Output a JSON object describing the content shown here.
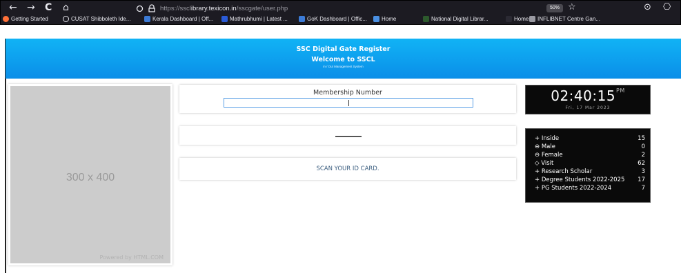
{
  "browser": {
    "nav": {
      "back": "←",
      "forward": "→",
      "reload": "C",
      "home": "⌂"
    },
    "url_prefix": "https://sscl",
    "url_domain": "ibrary.texicon.in",
    "url_path": "/sscgate/user.php",
    "zoom": "50%",
    "bookmarks": [
      {
        "label": "Getting Started",
        "icon_color": "#ff7139"
      },
      {
        "label": "CUSAT Shibboleth Ide...",
        "icon_color": "#e8e8ee"
      },
      {
        "label": "Kerala Dashboard | Off...",
        "icon_color": "#3c7bd6"
      },
      {
        "label": "Mathrubhumi | Latest ...",
        "icon_color": "#2a5bd7"
      },
      {
        "label": "GoK Dashboard | Offic...",
        "icon_color": "#3c7bd6"
      },
      {
        "label": "Home",
        "icon_color": "#4a90e2"
      },
      {
        "label": "National Digital Librar...",
        "icon_color": "#2d5a2d"
      },
      {
        "label": "Home",
        "icon_color": "#2b2a33"
      },
      {
        "label": "INFLIBNET Centre Gan...",
        "icon_color": "#9a9aa2"
      }
    ]
  },
  "header": {
    "title": "SSC Digital Gate Register",
    "welcome": "Welcome to SSCL",
    "subtitle": "in / Out Management System",
    "color": "#0a9aef"
  },
  "placeholder": {
    "text": "300 x 400",
    "powered": "Powered by HTML.COM"
  },
  "membership": {
    "label": "Membership Number",
    "value": ""
  },
  "scan": {
    "text": "SCAN YOUR ID CARD."
  },
  "clock": {
    "time": "02:40:15",
    "ampm": "PM",
    "date": "Fri, 17 Mar 2023"
  },
  "stats": [
    {
      "label": "+ Inside",
      "value": "15"
    },
    {
      "label": "⊖ Male",
      "value": "0"
    },
    {
      "label": "⊖ Female",
      "value": "2"
    },
    {
      "label": "◇ Visit",
      "value": "62"
    },
    {
      "label": "+ Research Scholar",
      "value": "3"
    },
    {
      "label": "+ Degree Students 2022-2025",
      "value": "17"
    },
    {
      "label": "+ PG Students 2022-2024",
      "value": "7"
    }
  ]
}
